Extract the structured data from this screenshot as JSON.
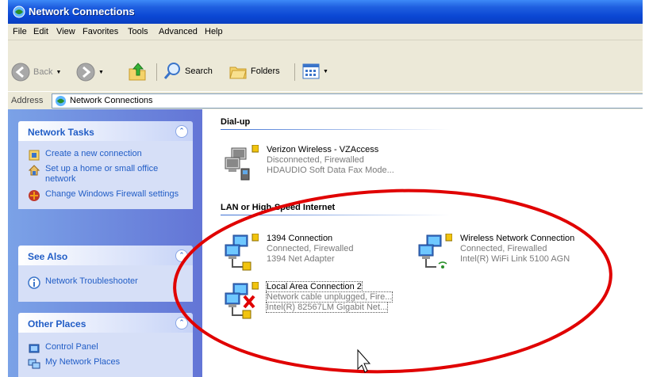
{
  "window": {
    "title": "Network Connections"
  },
  "menu": [
    "File",
    "Edit",
    "View",
    "Favorites",
    "Tools",
    "Advanced",
    "Help"
  ],
  "toolbar": {
    "back_label": "Back",
    "search_label": "Search",
    "folders_label": "Folders"
  },
  "address": {
    "label": "Address",
    "value": "Network Connections"
  },
  "network_tasks": {
    "title": "Network Tasks",
    "items": [
      {
        "label": "Create a new connection"
      },
      {
        "label": "Set up a home or small office network"
      },
      {
        "label": "Change Windows Firewall settings"
      }
    ]
  },
  "see_also": {
    "title": "See Also",
    "items": [
      {
        "label": "Network Troubleshooter"
      }
    ]
  },
  "other_places": {
    "title": "Other Places",
    "items": [
      {
        "label": "Control Panel"
      },
      {
        "label": "My Network Places"
      }
    ]
  },
  "groups": [
    {
      "title": "Dial-up",
      "connections": [
        {
          "name": "Verizon Wireless - VZAccess",
          "status": "Disconnected, Firewalled",
          "device": "HDAUDIO Soft Data Fax Mode..."
        }
      ]
    },
    {
      "title": "LAN or High-Speed Internet",
      "connections": [
        {
          "name": "1394 Connection",
          "status": "Connected, Firewalled",
          "device": "1394 Net Adapter"
        },
        {
          "name": "Wireless Network Connection",
          "status": "Connected, Firewalled",
          "device": "Intel(R) WiFi Link 5100 AGN"
        },
        {
          "name": "Local Area Connection 2",
          "status": "Network cable unplugged, Fire...",
          "device": "Intel(R) 82567LM Gigabit Net..."
        }
      ]
    }
  ],
  "colors": {
    "title_bar": "#0a46d3",
    "task_pane": "#6d8de0",
    "task_link": "#215dc6",
    "annotation": "#e00000"
  },
  "icons": {
    "network": "network-computers-icon",
    "lock": "padlock-icon",
    "error": "red-x-icon"
  }
}
